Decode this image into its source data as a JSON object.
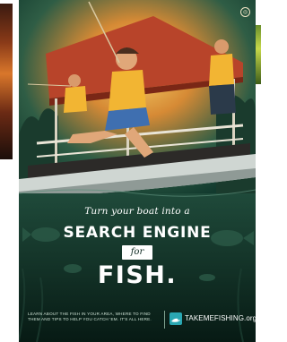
{
  "poster": {
    "tagline": "Turn your boat into a",
    "headline": "SEARCH ENGINE",
    "connector": "for",
    "fish_word": "FISH.",
    "footer_copy": "LEARN ABOUT THE FISH IN YOUR AREA, WHERE TO FIND THEM AND TIPS TO HELP YOU CATCH 'EM. IT'S ALL HERE.",
    "brand": "TAKEMEFISHING.org",
    "badge_glyph": "◎"
  },
  "colors": {
    "sky_top": "#1f5a4a",
    "sky_glow": "#f2c04a",
    "water": "#0b2a20",
    "boat_roof": "#c24a2a",
    "logo_teal": "#2aa7b2",
    "text_white": "#ffffff"
  },
  "icons": [
    "boat-illustration",
    "fishermen-illustration",
    "fish-silhouette-icon",
    "takemefishing-logo-icon",
    "seal-badge-icon"
  ]
}
